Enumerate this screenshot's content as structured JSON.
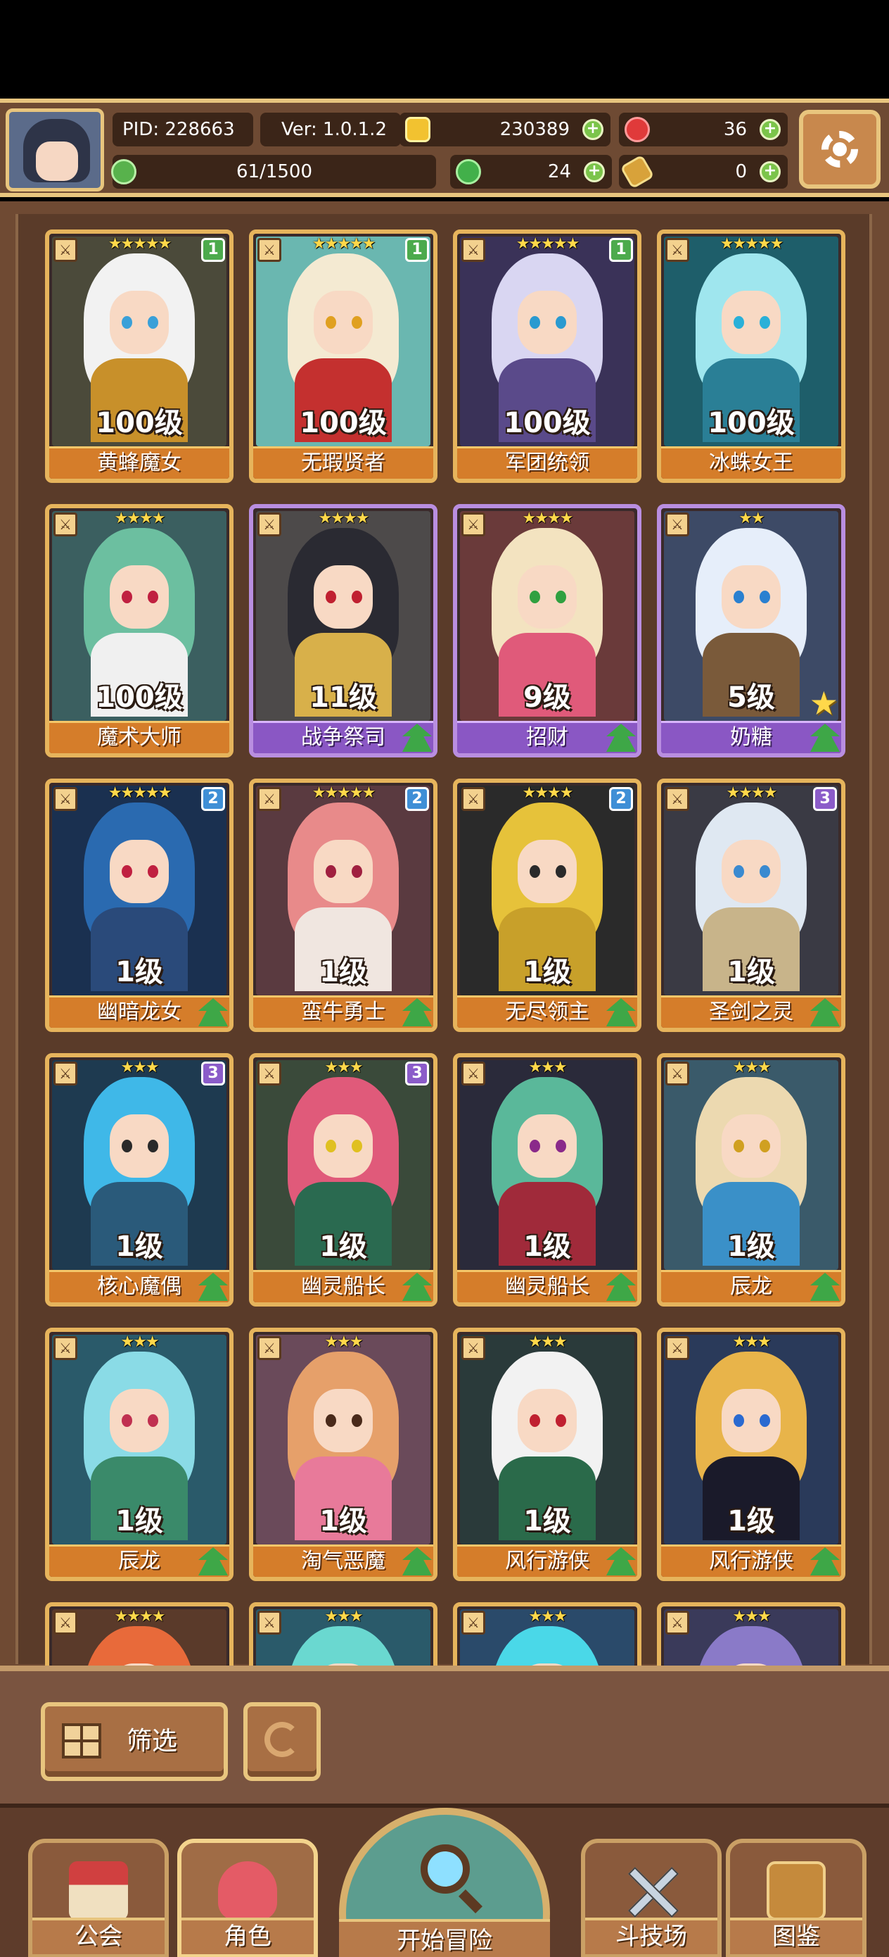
{
  "player": {
    "pid": "PID: 228663",
    "version": "Ver: 1.0.1.2",
    "gold": "230389",
    "gems": "36",
    "exp": "61/1500",
    "clover": "24",
    "keys": "0"
  },
  "cards": [
    {
      "name": "黄蜂魔女",
      "level": "100级",
      "stars": "★★★★★",
      "rank": "1",
      "rank_color": "g",
      "frame": "gold",
      "hair": "#f2f2f2",
      "body": "#c8902a",
      "eye": "#3aa0d8",
      "bg": "#4b4a3a",
      "upg": false
    },
    {
      "name": "无瑕贤者",
      "level": "100级",
      "stars": "★★★★★",
      "rank": "1",
      "rank_color": "g",
      "frame": "gold",
      "hair": "#f4ead2",
      "body": "#c4302f",
      "eye": "#e0a020",
      "bg": "#6ab7b0",
      "upg": false
    },
    {
      "name": "军团统领",
      "level": "100级",
      "stars": "★★★★★",
      "rank": "1",
      "rank_color": "g",
      "frame": "gold",
      "hair": "#d9d6f2",
      "body": "#5a4a8a",
      "eye": "#2a9ad0",
      "bg": "#3a3258",
      "upg": false
    },
    {
      "name": "冰蛛女王",
      "level": "100级",
      "stars": "★★★★★",
      "rank": "",
      "rank_color": "",
      "frame": "gold",
      "hair": "#9fe6ee",
      "body": "#2a7f96",
      "eye": "#2ab0d8",
      "bg": "#1e5e6a",
      "upg": false
    },
    {
      "name": "魔术大师",
      "level": "100级",
      "stars": "★★★★",
      "rank": "",
      "rank_color": "",
      "frame": "gold",
      "hair": "#6cbfa0",
      "body": "#f0f0f0",
      "eye": "#c02040",
      "bg": "#3b5f60",
      "upg": false
    },
    {
      "name": "战争祭司",
      "level": "11级",
      "stars": "★★★★",
      "rank": "",
      "rank_color": "",
      "frame": "purple",
      "hair": "#2a2a32",
      "body": "#d8b04a",
      "eye": "#c02030",
      "bg": "#4d4a4a",
      "upg": true
    },
    {
      "name": "招财",
      "level": "9级",
      "stars": "★★★★",
      "rank": "",
      "rank_color": "",
      "frame": "purple",
      "hair": "#f3e3c0",
      "body": "#e05a7a",
      "eye": "#30a040",
      "bg": "#6a3a3a",
      "upg": true
    },
    {
      "name": "奶糖",
      "level": "5级",
      "stars": "★★",
      "rank": "",
      "rank_color": "",
      "frame": "purple",
      "hair": "#e6eefa",
      "body": "#7a5a3a",
      "eye": "#2a80d0",
      "bg": "#3d4a66",
      "upg": true,
      "starbadge": true
    },
    {
      "name": "幽暗龙女",
      "level": "1级",
      "stars": "★★★★★",
      "rank": "2",
      "rank_color": "b",
      "frame": "gold",
      "hair": "#2a6ab0",
      "body": "#2a4a7a",
      "eye": "#c02040",
      "bg": "#1a3050",
      "upg": true
    },
    {
      "name": "蛮牛勇士",
      "level": "1级",
      "stars": "★★★★★",
      "rank": "2",
      "rank_color": "b",
      "frame": "gold",
      "hair": "#e88a8a",
      "body": "#f0e6e0",
      "eye": "#a02040",
      "bg": "#5a3a40",
      "upg": true
    },
    {
      "name": "无尽领主",
      "level": "1级",
      "stars": "★★★★",
      "rank": "2",
      "rank_color": "b",
      "frame": "gold",
      "hair": "#e6c23a",
      "body": "#c8a02a",
      "eye": "#2a2a2a",
      "bg": "#2a2a2a",
      "upg": true
    },
    {
      "name": "圣剑之灵",
      "level": "1级",
      "stars": "★★★★",
      "rank": "3",
      "rank_color": "p",
      "frame": "gold",
      "hair": "#dfe8f2",
      "body": "#c8b48a",
      "eye": "#3a8ad0",
      "bg": "#3a3a44",
      "upg": true
    },
    {
      "name": "核心魔偶",
      "level": "1级",
      "stars": "★★★",
      "rank": "3",
      "rank_color": "p",
      "frame": "gold",
      "hair": "#3fb8e8",
      "body": "#2a5a7a",
      "eye": "#2a2a2a",
      "bg": "#1e3a50",
      "upg": true
    },
    {
      "name": "幽灵船长",
      "level": "1级",
      "stars": "★★★",
      "rank": "3",
      "rank_color": "p",
      "frame": "gold",
      "hair": "#e05a7a",
      "body": "#2a6a50",
      "eye": "#e0c020",
      "bg": "#3a4a3a",
      "upg": true
    },
    {
      "name": "幽灵船长",
      "level": "1级",
      "stars": "★★★",
      "rank": "",
      "rank_color": "",
      "frame": "gold",
      "hair": "#5ab89a",
      "body": "#a02a3a",
      "eye": "#8a2a8a",
      "bg": "#2a2a3a",
      "upg": true
    },
    {
      "name": "辰龙",
      "level": "1级",
      "stars": "★★★",
      "rank": "",
      "rank_color": "",
      "frame": "gold",
      "hair": "#ecd9b0",
      "body": "#3a90c8",
      "eye": "#d0a020",
      "bg": "#3a5a6a",
      "upg": true
    },
    {
      "name": "辰龙",
      "level": "1级",
      "stars": "★★★",
      "rank": "",
      "rank_color": "",
      "frame": "gold",
      "hair": "#8adbe6",
      "body": "#3a8a6a",
      "eye": "#c03050",
      "bg": "#2a5a6a",
      "upg": true
    },
    {
      "name": "淘气恶魔",
      "level": "1级",
      "stars": "★★★",
      "rank": "",
      "rank_color": "",
      "frame": "gold",
      "hair": "#e6a06a",
      "body": "#e87a9a",
      "eye": "#4a2a1a",
      "bg": "#6a4a5a",
      "upg": true
    },
    {
      "name": "风行游侠",
      "level": "1级",
      "stars": "★★★",
      "rank": "",
      "rank_color": "",
      "frame": "gold",
      "hair": "#f2f2f2",
      "body": "#2a6a4a",
      "eye": "#c02030",
      "bg": "#2a3a3a",
      "upg": true
    },
    {
      "name": "风行游侠",
      "level": "1级",
      "stars": "★★★",
      "rank": "",
      "rank_color": "",
      "frame": "gold",
      "hair": "#e8b44a",
      "body": "#1a1a2a",
      "eye": "#2a6ad0",
      "bg": "#2a3a5a",
      "upg": true
    },
    {
      "name": "",
      "level": "",
      "stars": "★★★★",
      "rank": "",
      "rank_color": "",
      "frame": "gold",
      "hair": "#e86a3a",
      "body": "#f0b040",
      "eye": "#2a2a2a",
      "bg": "#5a3a2a",
      "upg": false
    },
    {
      "name": "",
      "level": "",
      "stars": "★★★",
      "rank": "",
      "rank_color": "",
      "frame": "gold",
      "hair": "#6ad8d0",
      "body": "#2a8a8a",
      "eye": "#2a2a2a",
      "bg": "#2a5a6a",
      "upg": false
    },
    {
      "name": "",
      "level": "",
      "stars": "★★★",
      "rank": "",
      "rank_color": "",
      "frame": "gold",
      "hair": "#4ad8e8",
      "body": "#2a7a9a",
      "eye": "#2a2a2a",
      "bg": "#2a4a6a",
      "upg": false
    },
    {
      "name": "",
      "level": "",
      "stars": "★★★",
      "rank": "",
      "rank_color": "",
      "frame": "gold",
      "hair": "#8a7ac8",
      "body": "#4a3a6a",
      "eye": "#2a2a2a",
      "bg": "#3a3a5a",
      "upg": false
    }
  ],
  "filter": {
    "label": "筛选"
  },
  "nav": {
    "guild": "公会",
    "character": "角色",
    "adventure": "开始冒险",
    "arena": "斗技场",
    "codex": "图鉴"
  }
}
